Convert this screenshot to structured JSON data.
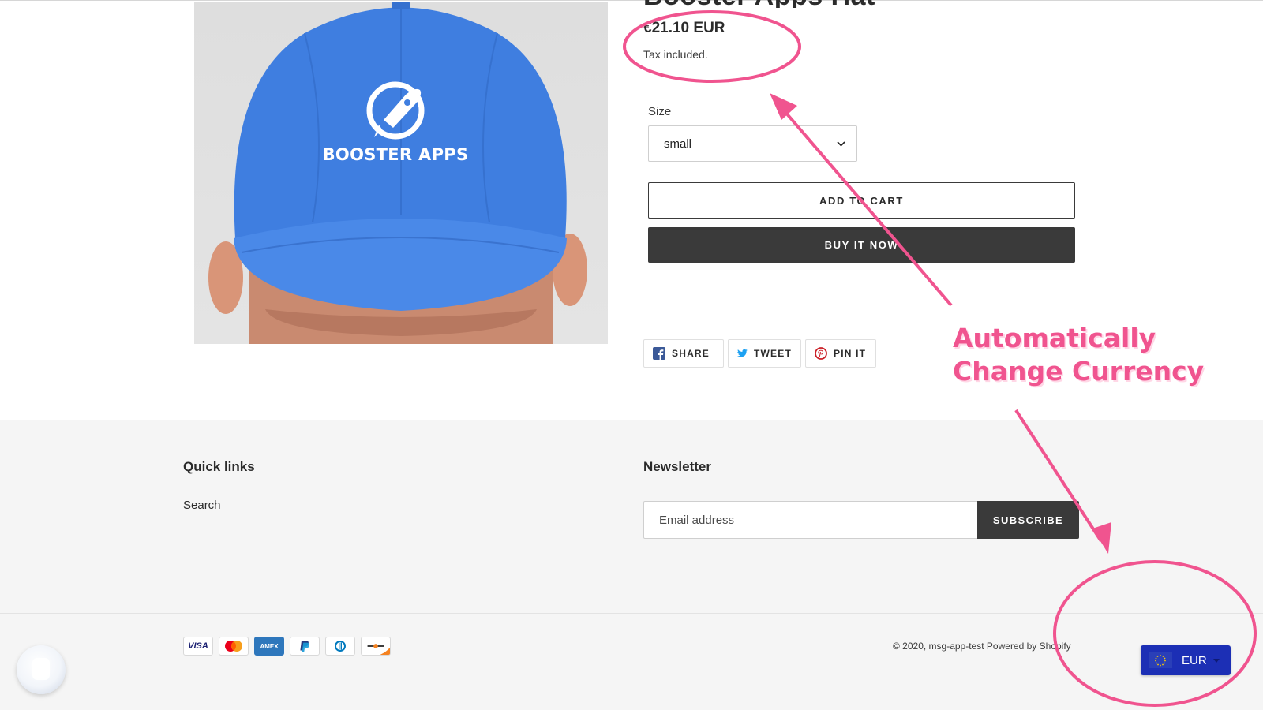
{
  "product": {
    "title": "Booster Apps Hat",
    "price": "€21.10 EUR",
    "tax_note": "Tax included.",
    "size_label": "Size",
    "size_value": "small",
    "add_to_cart": "ADD TO CART",
    "buy_now": "BUY IT NOW",
    "image_logo_text": "BOOSTER APPS"
  },
  "share": {
    "facebook": "SHARE",
    "twitter": "TWEET",
    "pinterest": "PIN IT"
  },
  "footer": {
    "quick_links_heading": "Quick links",
    "quick_links": [
      "Search"
    ],
    "newsletter_heading": "Newsletter",
    "email_placeholder": "Email address",
    "subscribe": "SUBSCRIBE",
    "payment_methods": [
      "VISA",
      "Mastercard",
      "AMEX",
      "PayPal",
      "Diners Club",
      "Discover"
    ],
    "copyright": "© 2020, msg-app-test",
    "powered_by": "Powered by Shopify"
  },
  "currency_switcher": {
    "currency": "EUR",
    "flag_icon": "eu-flag-icon"
  },
  "annotation": {
    "callout_line1": "Automatically",
    "callout_line2": "Change Currency",
    "color": "#f0548f"
  },
  "colors": {
    "button_dark": "#3a3a3a",
    "footer_bg": "#f5f5f5",
    "switcher_bg": "#1c2fb5",
    "hat_blue": "#3f7ee0"
  }
}
